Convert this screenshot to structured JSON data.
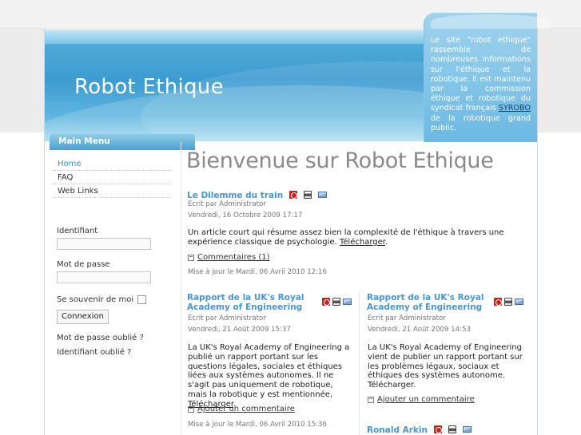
{
  "site": {
    "title": "Robot Ethique",
    "info_text_before": "Le site \"robot ethique\" rassemble de nombreuses informations sur l'éthique et la robotique. Il est maintenu par la commission éthique et robotique du syndicat français ",
    "info_link": "SYROBO",
    "info_text_after": " de la robotique grand public."
  },
  "menu": {
    "title": "Main Menu",
    "items": [
      {
        "label": "Home"
      },
      {
        "label": "FAQ"
      },
      {
        "label": "Web Links"
      }
    ]
  },
  "login": {
    "username_label": "Identifiant",
    "password_label": "Mot de passe",
    "remember_label": "Se souvenir de moi",
    "submit_label": "Connexion",
    "forgot_password": "Mot de passe oublié ?",
    "forgot_username": "Identifiant oublié ?"
  },
  "main": {
    "title": "Bienvenue sur Robot Ethique",
    "lead_article": {
      "title": "Le Dilemme du train",
      "author": "Écrit par Administrator",
      "date": "Vendredi, 16 Octobre 2009 17:17",
      "body": "Un article court qui résume assez bien la complexité de l'éthique à travers une expérience classique de psychologie. ",
      "download": "Télécharger",
      "body_end": ".",
      "comments": "Commentaires (1)",
      "updated": "Mise à jour le Mardi, 06 Avril 2010 12:16"
    },
    "left_article": {
      "title": "Rapport de la UK's Royal Academy of Engineering",
      "author": "Écrit par Administrator",
      "date": "Vendredi, 21 Août 2009 15:37",
      "body": "La UK's Royal Academy of Engineering a publié un rapport portant sur les questions légales, sociales et éthiques liées aux systèmes autonomes. Il ne s'agit pas uniquement de robotique, mais la robotique y est mentionnée, ",
      "download": "Télécharger",
      "body_end": ".",
      "comments": "Ajouter un commentaire",
      "updated": "Mise à jour le Mardi, 06 Avril 2010 15:36"
    },
    "right_article": {
      "title": "Rapport de la UK's Royal Academy of Engineering",
      "author": "Écrit par Administrator",
      "date": "Vendredi, 21 Août 2009 14:53",
      "body": "La UK's Royal Academy of Engineering vient de publier un rapport portant sur les problèmes légaux, sociaux et éthiques des systèmes autonome. Télécharger.",
      "comments": "Ajouter un commentaire"
    },
    "next_article": {
      "title": "Ronald Arkin"
    }
  },
  "icons": {
    "pdf": "pdf-icon",
    "print": "print-icon",
    "email": "email-icon",
    "comment": "comment-icon"
  },
  "colors": {
    "accent": "#4a96cf",
    "header_blue": "#3c9bd0",
    "title_grey": "#8a8a8a"
  }
}
